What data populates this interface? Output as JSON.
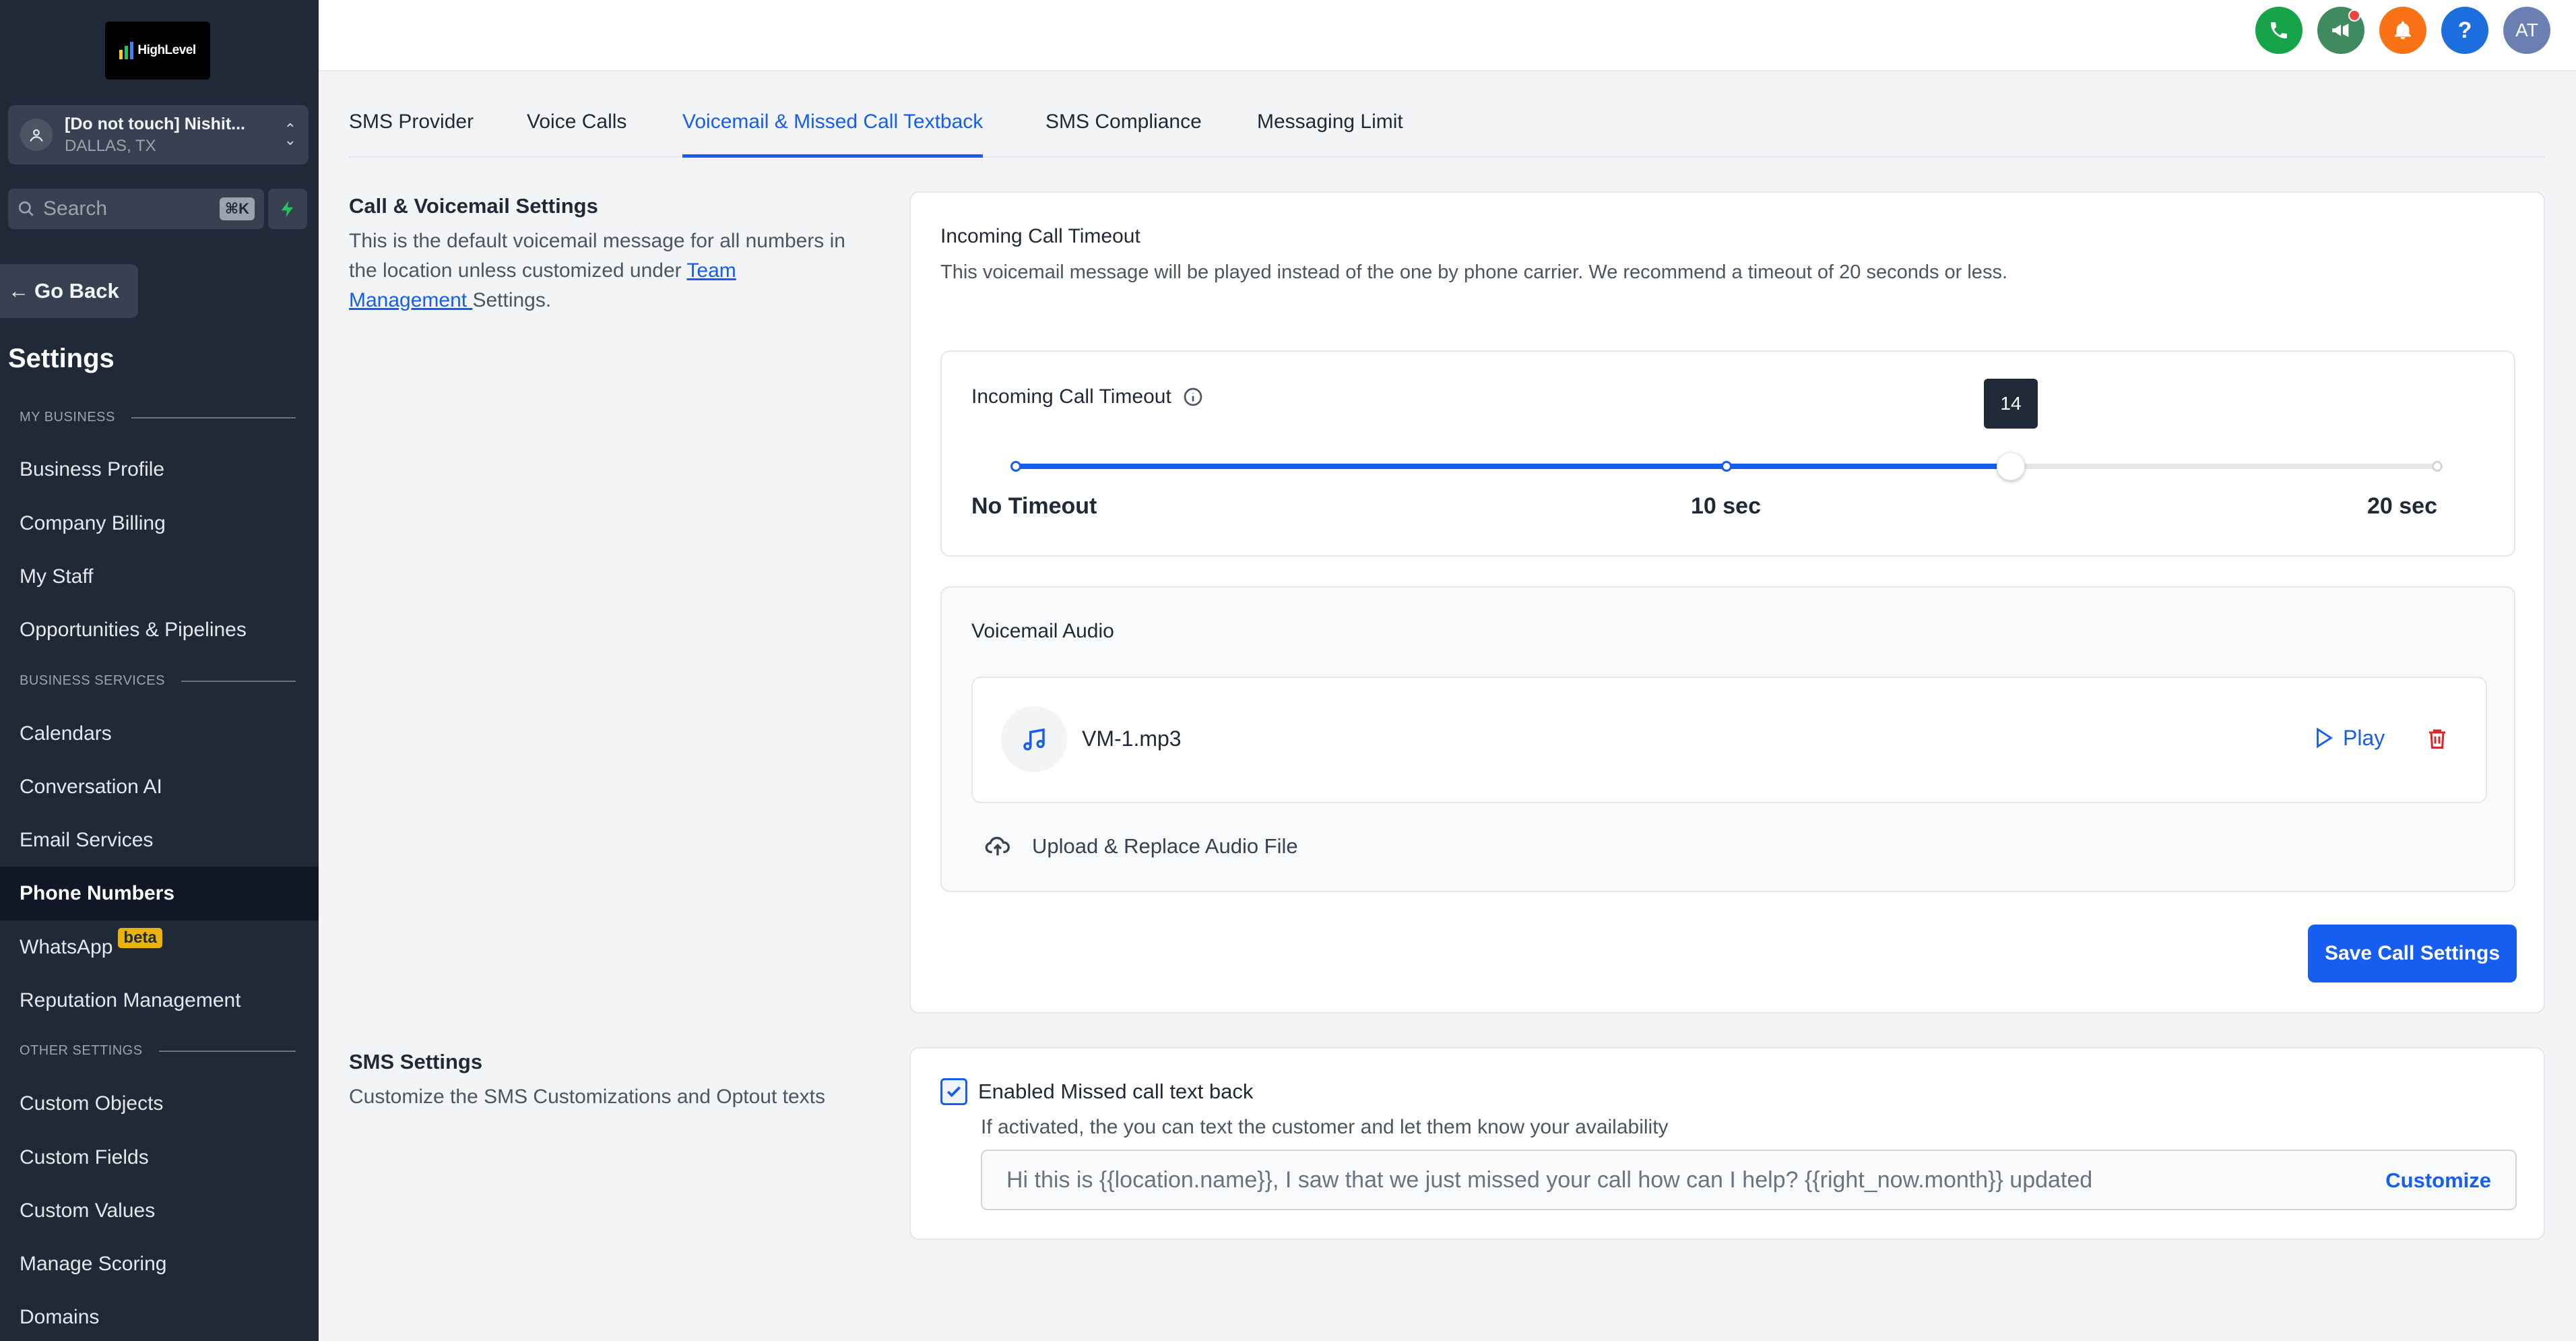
{
  "brand": {
    "name": "HighLevel",
    "bar_colors": [
      "#facc15",
      "#22c55e",
      "#3b82f6"
    ]
  },
  "sidebar": {
    "location_name": "[Do not touch] Nishit...",
    "location_city": "DALLAS, TX",
    "search_placeholder": "Search",
    "search_shortcut": "⌘K",
    "go_back": "Go Back",
    "title": "Settings",
    "sections": [
      {
        "label": "MY BUSINESS"
      },
      {
        "label": "BUSINESS SERVICES"
      },
      {
        "label": "OTHER SETTINGS"
      }
    ],
    "items": [
      {
        "label": "Business Profile"
      },
      {
        "label": "Company Billing"
      },
      {
        "label": "My Staff"
      },
      {
        "label": "Opportunities & Pipelines"
      },
      {
        "label": "Calendars"
      },
      {
        "label": "Conversation AI"
      },
      {
        "label": "Email Services"
      },
      {
        "label": "Phone Numbers",
        "active": true
      },
      {
        "label": "WhatsApp",
        "badge": "beta"
      },
      {
        "label": "Reputation Management"
      },
      {
        "label": "Custom Objects"
      },
      {
        "label": "Custom Fields"
      },
      {
        "label": "Custom Values"
      },
      {
        "label": "Manage Scoring"
      },
      {
        "label": "Domains"
      }
    ]
  },
  "header": {
    "avatar_initials": "AT",
    "icons": [
      "phone-icon",
      "megaphone-icon",
      "bell-icon",
      "help-icon"
    ],
    "colors": {
      "phone": "#16a34a",
      "megaphone": "#3f8a5e",
      "bell": "#f97316",
      "help": "#1d6fe0",
      "avatar": "#6b7fb3"
    }
  },
  "tabs": [
    {
      "label": "SMS Provider"
    },
    {
      "label": "Voice Calls"
    },
    {
      "label": "Voicemail & Missed Call Textback",
      "active": true
    },
    {
      "label": "SMS Compliance"
    },
    {
      "label": "Messaging Limit"
    }
  ],
  "call_section": {
    "title": "Call & Voicemail Settings",
    "desc_before_link": "This is the default voicemail message for all numbers in the location unless customized under ",
    "link": "Team Management ",
    "desc_after_link": "Settings."
  },
  "call_card": {
    "title": "Incoming Call Timeout",
    "description": "This voicemail message will be played instead of the one by phone carrier. We recommend a timeout of 20 seconds or less.",
    "timeout": {
      "label": "Incoming Call Timeout",
      "value": 14,
      "min": 0,
      "max": 20,
      "tooltip": "14",
      "tick_labels": [
        "No Timeout",
        "10 sec",
        "20 sec"
      ]
    },
    "voicemail": {
      "title": "Voicemail Audio",
      "file_name": "VM-1.mp3",
      "play_label": "Play",
      "upload_label": "Upload & Replace Audio File"
    },
    "save_label": "Save Call Settings"
  },
  "sms_section": {
    "title": "SMS Settings",
    "description": "Customize the SMS Customizations and Optout texts"
  },
  "sms_card": {
    "checkbox_label": "Enabled Missed call text back",
    "checked": true,
    "helper": "If activated, the you can text the customer and let them know your availability",
    "message": "Hi this is {{location.name}}, I saw that we just missed your call how can I help? {{right_now.month}} updated",
    "customize_label": "Customize"
  },
  "colors": {
    "accent": "#155eef",
    "danger": "#dc2626",
    "sidebar_bg": "#1f2937"
  }
}
